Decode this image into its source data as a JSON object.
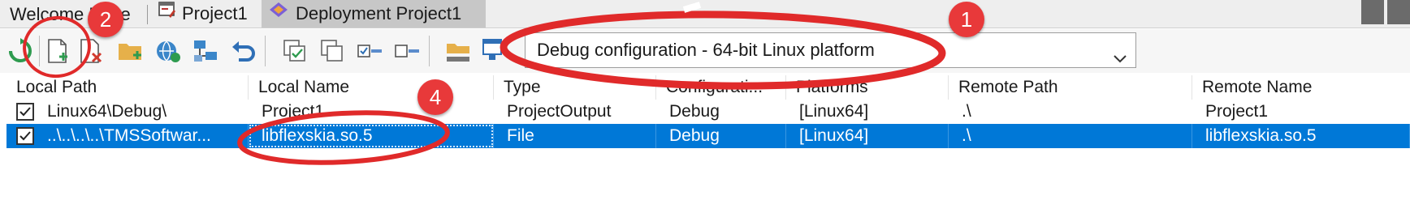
{
  "tabs": {
    "welcome": "Welcome Page",
    "project": "Project1",
    "deployment": "Deployment Project1"
  },
  "toolbar": {
    "icons": [
      "refresh-icon",
      "add-files-icon",
      "remove-files-icon",
      "add-folder-icon",
      "connect-icon",
      "platform-settings-icon",
      "revert-icon",
      "copy-config-icon",
      "duplicate-icon",
      "collapse-icon",
      "expand-icon",
      "open-folder-icon",
      "deploy-icon"
    ],
    "config_value": "Debug configuration - 64-bit Linux platform"
  },
  "grid": {
    "columns": [
      "Local Path",
      "Local Name",
      "Type",
      "Configurati...",
      "Platforms",
      "Remote Path",
      "Remote Name"
    ],
    "rows": [
      {
        "checked": true,
        "local_path": "Linux64\\Debug\\",
        "local_name": "Project1",
        "type": "ProjectOutput",
        "configuration": "Debug",
        "platforms": "[Linux64]",
        "remote_path": ".\\",
        "remote_name": "Project1",
        "selected": false
      },
      {
        "checked": true,
        "local_path": "..\\..\\..\\..\\TMSSoftwar...",
        "local_name": "libflexskia.so.5",
        "type": "File",
        "configuration": "Debug",
        "platforms": "[Linux64]",
        "remote_path": ".\\",
        "remote_name": "libflexskia.so.5",
        "selected": true
      }
    ]
  },
  "annotations": {
    "badge_1": "1",
    "badge_2": "2",
    "badge_4": "4"
  },
  "colors": {
    "selection": "#0078d7",
    "annotation_red": "#e8393a"
  }
}
